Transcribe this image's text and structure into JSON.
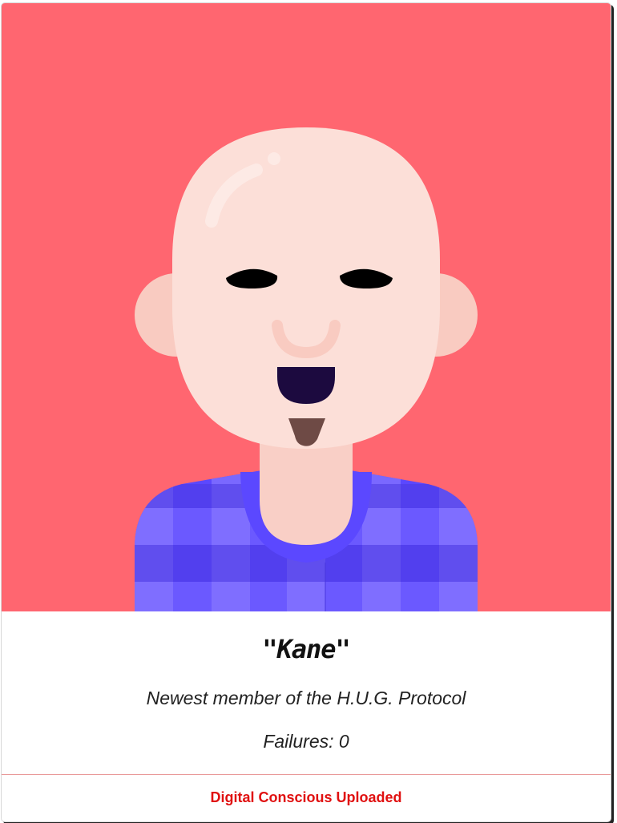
{
  "profile": {
    "name": "\"Kane\"",
    "subtitle": "Newest member of the H.U.G. Protocol",
    "failures": "Failures: 0",
    "status": "Digital Conscious Uploaded"
  },
  "avatar": {
    "background_color": "#ff6670",
    "skin_color": "#fcdfd8",
    "ear_color": "#f9cbc1",
    "shirt_color": "#5b48ff",
    "mouth_color": "#1c0a3f",
    "tongue_color": "#6e4a45",
    "expression": "eyes-closed-smiling"
  },
  "theme": {
    "status_color": "#e01010",
    "divider_color": "#e99a9a"
  }
}
